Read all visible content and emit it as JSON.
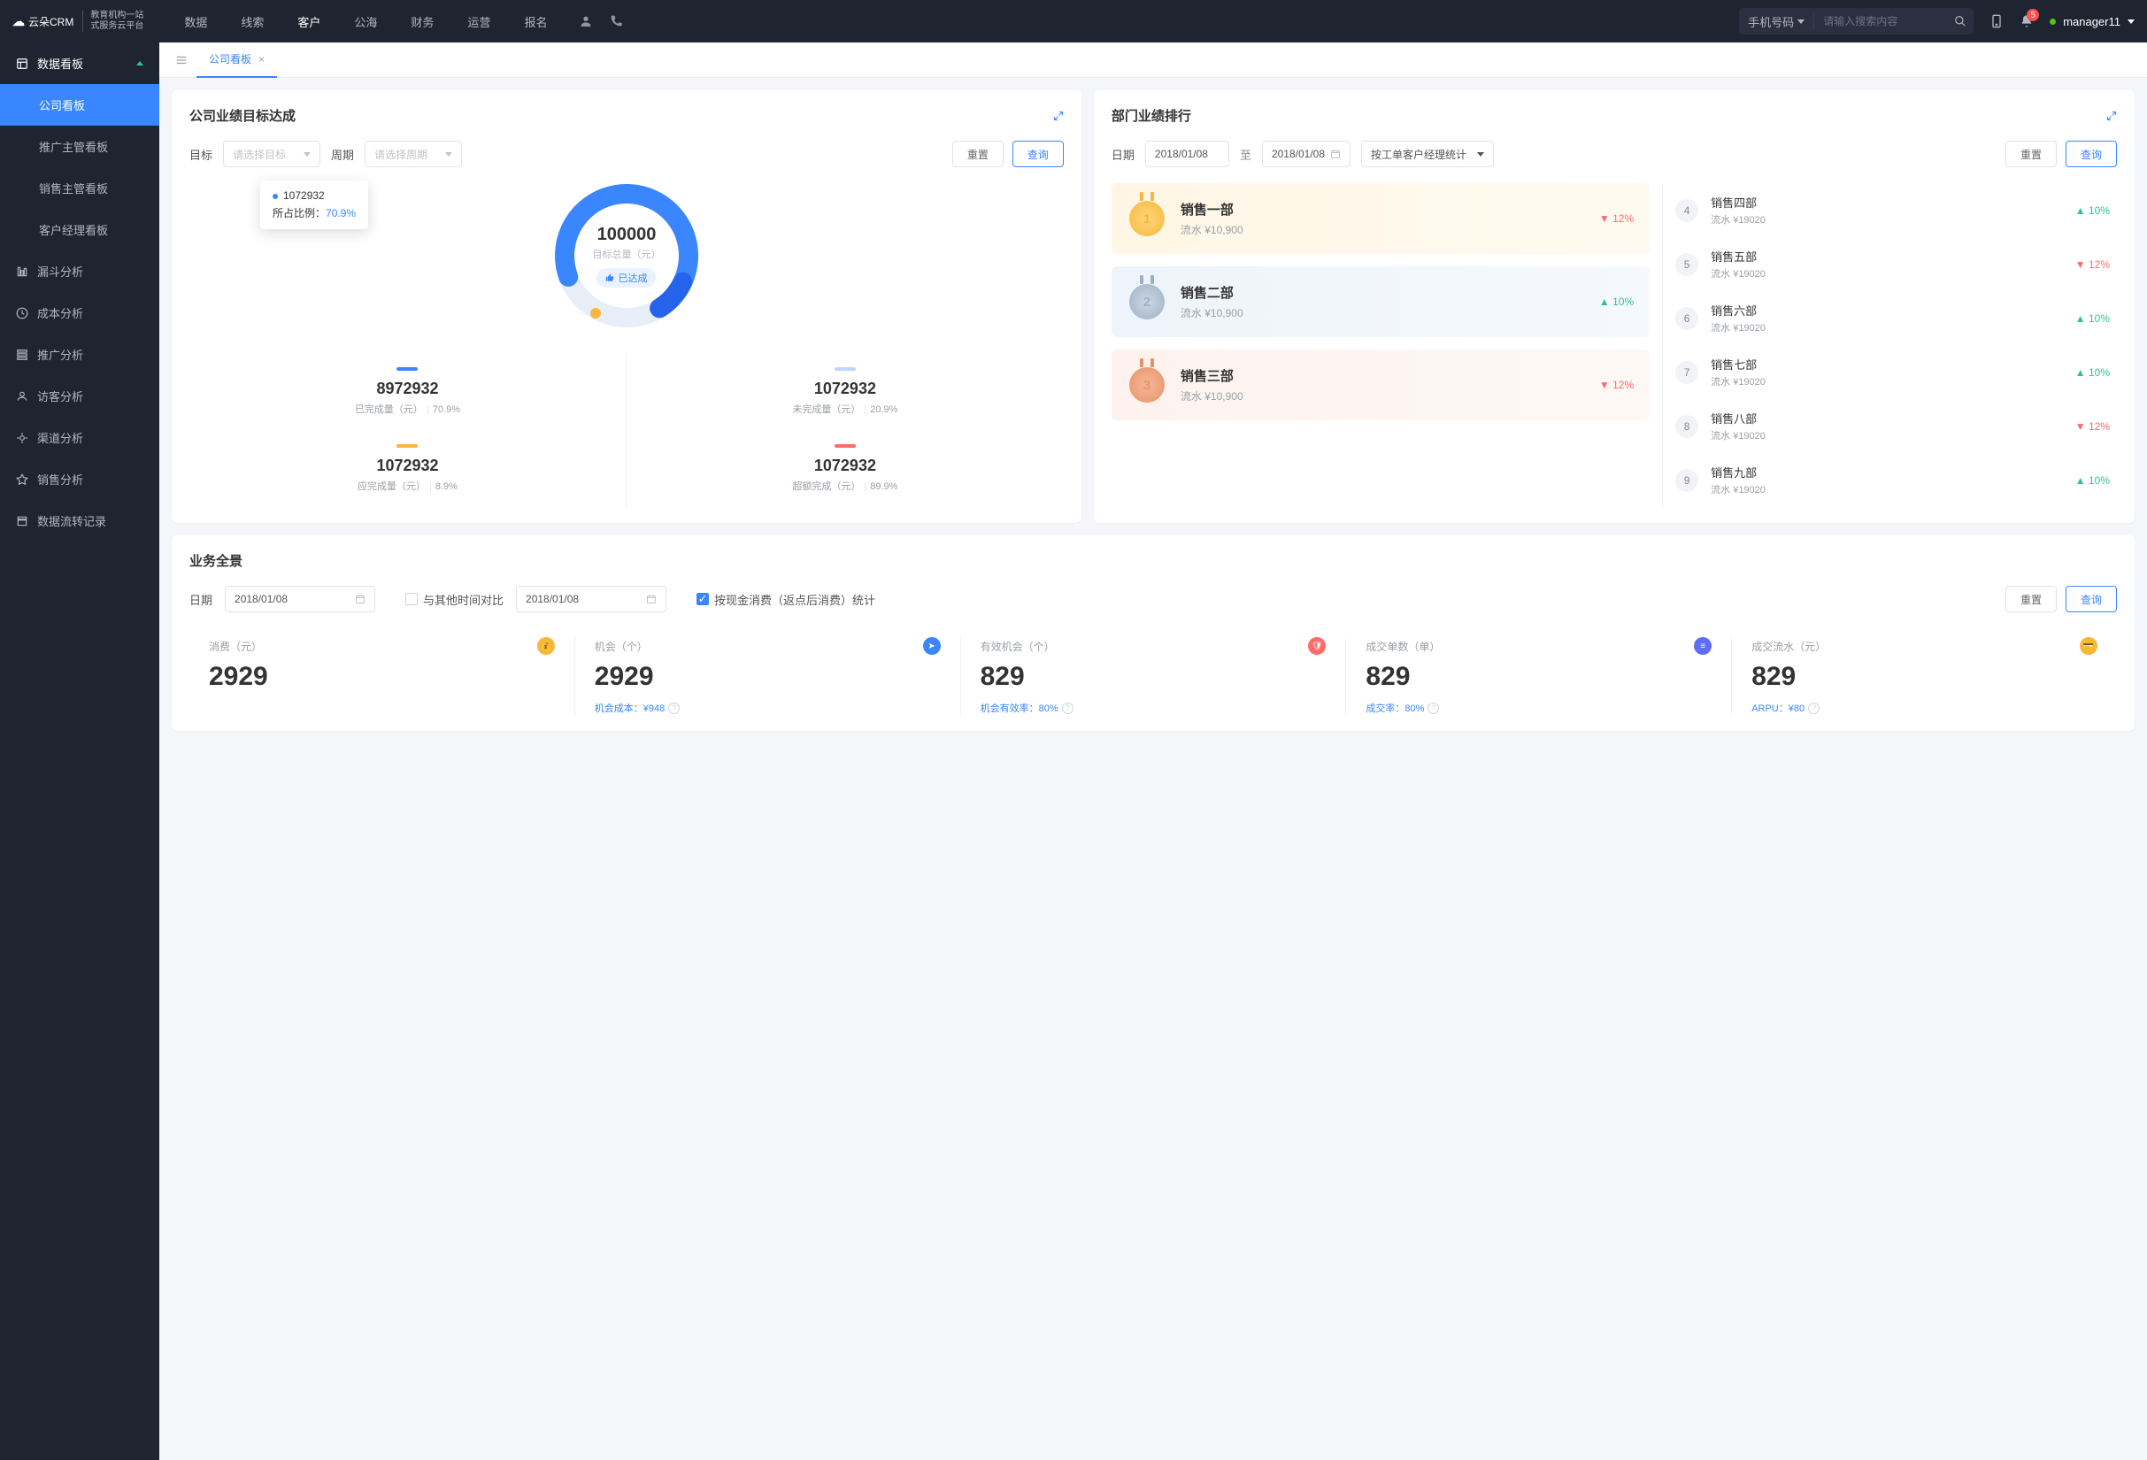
{
  "brand": {
    "name": "云朵CRM",
    "sub1": "教育机构一站",
    "sub2": "式服务云平台"
  },
  "topnav": [
    "数据",
    "线索",
    "客户",
    "公海",
    "财务",
    "运营",
    "报名"
  ],
  "topnav_active": 2,
  "search": {
    "type_label": "手机号码",
    "placeholder": "请输入搜索内容"
  },
  "notif_count": "5",
  "user": {
    "name": "manager11"
  },
  "sidebar": {
    "group": "数据看板",
    "subs": [
      "公司看板",
      "推广主管看板",
      "销售主管看板",
      "客户经理看板"
    ],
    "active_sub": 0,
    "items": [
      "漏斗分析",
      "成本分析",
      "推广分析",
      "访客分析",
      "渠道分析",
      "销售分析",
      "数据流转记录"
    ]
  },
  "tab": {
    "label": "公司看板"
  },
  "goal_card": {
    "title": "公司业绩目标达成",
    "labels": {
      "target": "目标",
      "period": "周期",
      "target_ph": "请选择目标",
      "period_ph": "请选择周期",
      "reset": "重置",
      "query": "查询"
    },
    "tooltip": {
      "value": "1072932",
      "ratio_label": "所占比例：",
      "ratio": "70.9%"
    },
    "donut": {
      "total": "100000",
      "total_label": "目标总量（元）",
      "badge": "已达成"
    },
    "legend": [
      {
        "color": "#3a86ff",
        "value": "8972932",
        "label": "已完成量（元）",
        "pct": "70.9%"
      },
      {
        "color": "#bcd6ff",
        "value": "1072932",
        "label": "未完成量（元）",
        "pct": "20.9%"
      },
      {
        "color": "#f6b73c",
        "value": "1072932",
        "label": "应完成量（元）",
        "pct": "8.9%"
      },
      {
        "color": "#ff6b6b",
        "value": "1072932",
        "label": "超额完成（元）",
        "pct": "89.9%"
      }
    ]
  },
  "rank_card": {
    "title": "部门业绩排行",
    "labels": {
      "date": "日期",
      "date_from": "2018/01/08",
      "date_to": "2018/01/08",
      "join": "至",
      "group_by": "按工单客户经理统计",
      "reset": "重置",
      "query": "查询"
    },
    "top3": [
      {
        "rank": "1",
        "name": "销售一部",
        "sub": "流水 ¥10,900",
        "pct": "12%",
        "dir": "down"
      },
      {
        "rank": "2",
        "name": "销售二部",
        "sub": "流水 ¥10,900",
        "pct": "10%",
        "dir": "up"
      },
      {
        "rank": "3",
        "name": "销售三部",
        "sub": "流水 ¥10,900",
        "pct": "12%",
        "dir": "down"
      }
    ],
    "rest": [
      {
        "rank": "4",
        "name": "销售四部",
        "sub": "流水 ¥19020",
        "pct": "10%",
        "dir": "up"
      },
      {
        "rank": "5",
        "name": "销售五部",
        "sub": "流水 ¥19020",
        "pct": "12%",
        "dir": "down"
      },
      {
        "rank": "6",
        "name": "销售六部",
        "sub": "流水 ¥19020",
        "pct": "10%",
        "dir": "up"
      },
      {
        "rank": "7",
        "name": "销售七部",
        "sub": "流水 ¥19020",
        "pct": "10%",
        "dir": "up"
      },
      {
        "rank": "8",
        "name": "销售八部",
        "sub": "流水 ¥19020",
        "pct": "12%",
        "dir": "down"
      },
      {
        "rank": "9",
        "name": "销售九部",
        "sub": "流水 ¥19020",
        "pct": "10%",
        "dir": "up"
      }
    ]
  },
  "overview": {
    "title": "业务全景",
    "labels": {
      "date": "日期",
      "date_val": "2018/01/08",
      "compare": "与其他时间对比",
      "date2_val": "2018/01/08",
      "cash_stat": "按现金消费（返点后消费）统计",
      "reset": "重置",
      "query": "查询"
    },
    "metrics": [
      {
        "label": "消费（元）",
        "value": "2929",
        "sub": "",
        "icon_bg": "#f6b73c"
      },
      {
        "label": "机会（个）",
        "value": "2929",
        "sub": "机会成本：¥948",
        "icon_bg": "#3a86ff"
      },
      {
        "label": "有效机会（个）",
        "value": "829",
        "sub": "机会有效率：80%",
        "icon_bg": "#ff6b6b"
      },
      {
        "label": "成交单数（单）",
        "value": "829",
        "sub": "成交率：80%",
        "icon_bg": "#5b6ef5"
      },
      {
        "label": "成交流水（元）",
        "value": "829",
        "sub": "ARPU：¥80",
        "icon_bg": "#f6b73c"
      }
    ]
  },
  "chart_data": {
    "type": "pie",
    "title": "公司业绩目标达成",
    "total": 100000,
    "series": [
      {
        "name": "已完成量（元）",
        "value": 8972932,
        "pct": 70.9
      },
      {
        "name": "未完成量（元）",
        "value": 1072932,
        "pct": 20.9
      },
      {
        "name": "应完成量（元）",
        "value": 1072932,
        "pct": 8.9
      },
      {
        "name": "超额完成（元）",
        "value": 1072932,
        "pct": 89.9
      }
    ]
  }
}
